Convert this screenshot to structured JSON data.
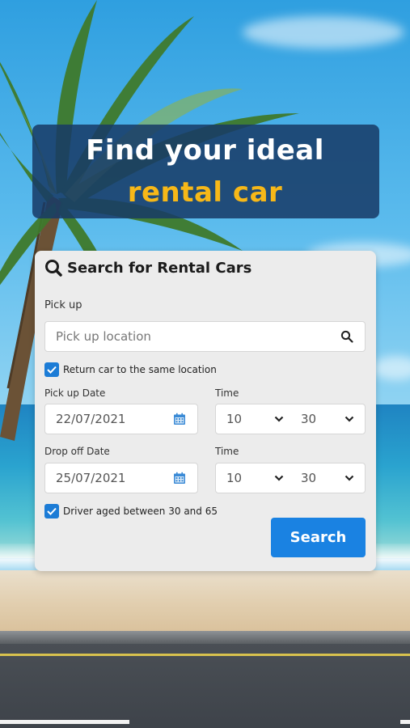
{
  "banner": {
    "line1": "Find your ideal",
    "line2": "rental car"
  },
  "card": {
    "title": "Search for Rental Cars",
    "pickup": {
      "label": "Pick up",
      "placeholder": "Pick up location"
    },
    "return_same": {
      "checked": true,
      "label": "Return car to the same location"
    },
    "pickup_date": {
      "label": "Pick up Date",
      "value": "22/07/2021"
    },
    "pickup_time": {
      "label": "Time",
      "hour": "10",
      "minute": "30"
    },
    "dropoff_date": {
      "label": "Drop off Date",
      "value": "25/07/2021"
    },
    "dropoff_time": {
      "label": "Time",
      "hour": "10",
      "minute": "30"
    },
    "driver_age": {
      "checked": true,
      "label": "Driver aged between 30 and 65"
    },
    "search_button": "Search"
  },
  "colors": {
    "accent": "#1a82e2",
    "banner_bg": "#173a66",
    "banner_highlight": "#f7b818",
    "card_bg": "#ececec"
  }
}
